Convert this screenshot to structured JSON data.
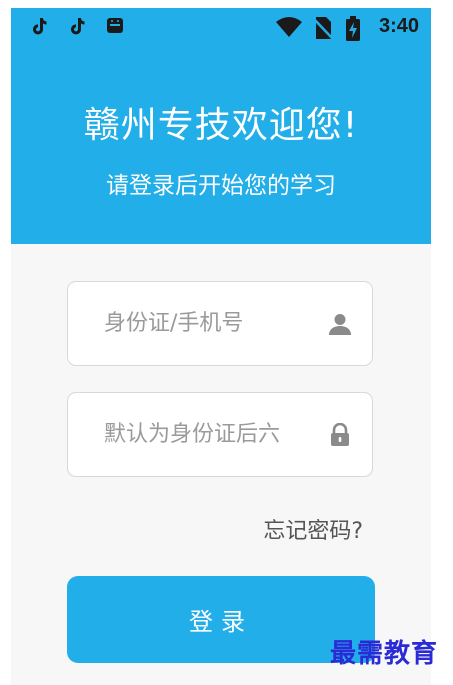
{
  "status_bar": {
    "time": "3:40",
    "icons": [
      "tiktok-icon",
      "tiktok-icon",
      "android-icon",
      "wifi-icon",
      "no-sim-icon",
      "battery-charging-icon"
    ]
  },
  "header": {
    "title": "赣州专技欢迎您!",
    "subtitle": "请登录后开始您的学习",
    "background_color": "#22aee9"
  },
  "form": {
    "username": {
      "value": "",
      "placeholder": "身份证/手机号",
      "icon": "user-icon"
    },
    "password": {
      "value": "",
      "placeholder": "默认为身份证后六",
      "icon": "lock-icon"
    },
    "forgot_password_label": "忘记密码?",
    "login_label": "登录",
    "accent_color": "#22aee9"
  },
  "watermark": {
    "text": "最需教育"
  }
}
